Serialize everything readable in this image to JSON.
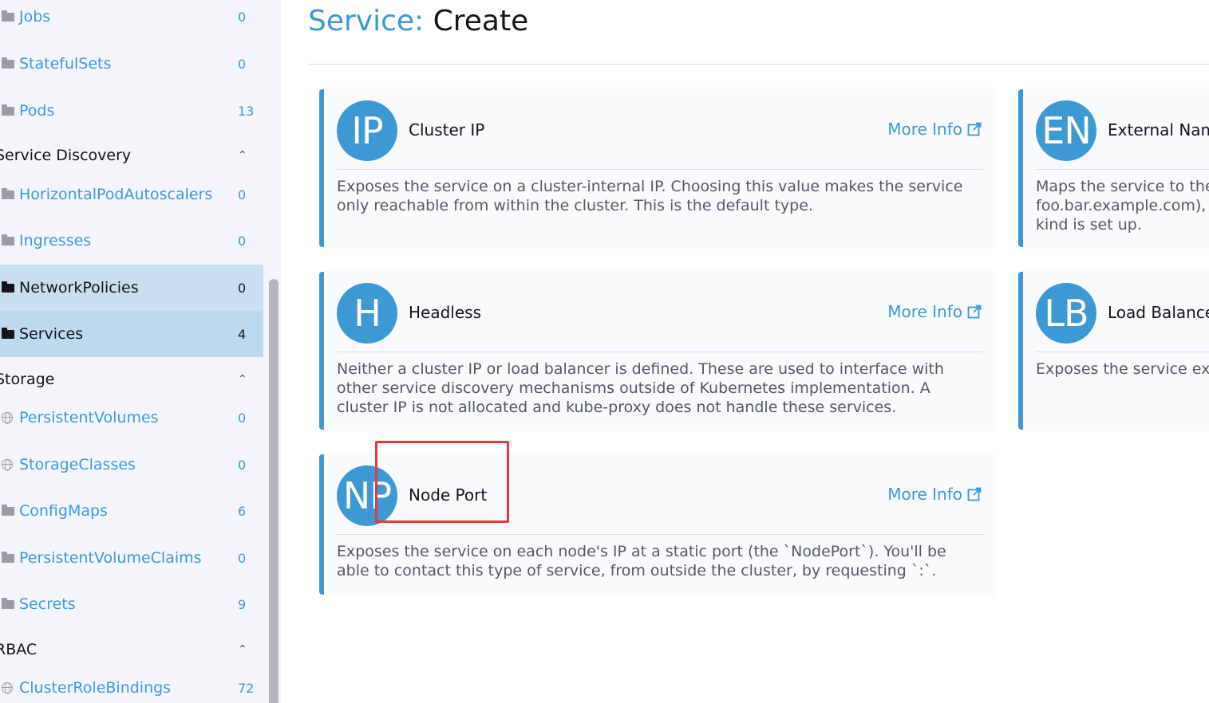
{
  "sidebar": {
    "items": [
      {
        "label": "Jobs",
        "count": "0",
        "icon": "folder-icon"
      },
      {
        "label": "StatefulSets",
        "count": "0",
        "icon": "folder-icon"
      },
      {
        "label": "Pods",
        "count": "13",
        "icon": "folder-icon"
      },
      {
        "label": "HorizontalPodAutoscalers",
        "count": "0",
        "icon": "folder-icon"
      },
      {
        "label": "Ingresses",
        "count": "0",
        "icon": "folder-icon"
      },
      {
        "label": "NetworkPolicies",
        "count": "0",
        "icon": "folder-icon"
      },
      {
        "label": "Services",
        "count": "4",
        "icon": "folder-icon"
      },
      {
        "label": "PersistentVolumes",
        "count": "0",
        "icon": "globe-icon"
      },
      {
        "label": "StorageClasses",
        "count": "0",
        "icon": "globe-icon"
      },
      {
        "label": "ConfigMaps",
        "count": "6",
        "icon": "folder-icon"
      },
      {
        "label": "PersistentVolumeClaims",
        "count": "0",
        "icon": "folder-icon"
      },
      {
        "label": "Secrets",
        "count": "9",
        "icon": "folder-icon"
      },
      {
        "label": "ClusterRoleBindings",
        "count": "72",
        "icon": "globe-icon"
      }
    ],
    "groups": [
      {
        "label": "Service Discovery",
        "chevron": "⌃"
      },
      {
        "label": "Storage",
        "chevron": "⌃"
      },
      {
        "label": "RBAC",
        "chevron": "⌃"
      }
    ]
  },
  "header": {
    "title_prefix": "Service:",
    "title_action": "Create"
  },
  "cards": [
    {
      "avatar": "IP",
      "title": "Cluster IP",
      "more": "More Info",
      "desc": "Exposes the service on a cluster-internal IP. Choosing this value makes the service only reachable from within the cluster. This is the default type."
    },
    {
      "avatar": "EN",
      "title": "External Nam",
      "more": "More Info",
      "desc": "Maps the service to the foo.bar.example.com), l kind is set up."
    },
    {
      "avatar": "H",
      "title": "Headless",
      "more": "More Info",
      "desc": "Neither a cluster IP or load balancer is defined. These are used to interface with other service discovery mechanisms outside of Kubernetes implementation. A cluster IP is not allocated and kube-proxy does not handle these services."
    },
    {
      "avatar": "LB",
      "title": "Load Balance",
      "more": "More Info",
      "desc": "Exposes the service ext"
    },
    {
      "avatar": "NP",
      "title": "Node Port",
      "more": "More Info",
      "desc": "Exposes the service on each node's IP at a static port (the `NodePort`). You'll be able to contact this type of service, from outside the cluster, by requesting `:`."
    }
  ],
  "colors": {
    "accent": "#3d98d3",
    "highlight": "#e8373f",
    "active_row": "#c8dff0"
  }
}
